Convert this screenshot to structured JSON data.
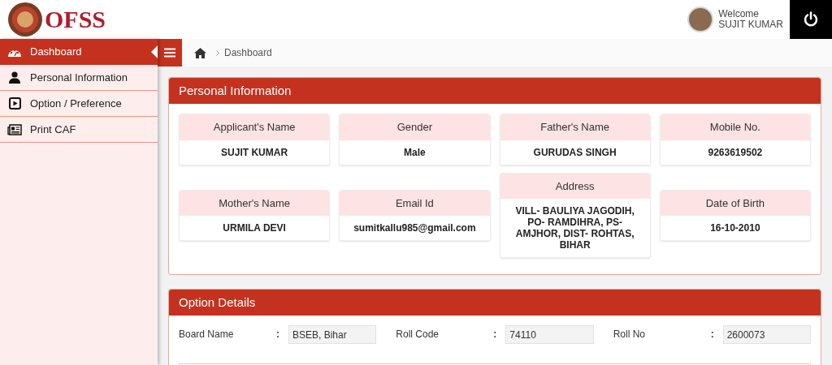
{
  "header": {
    "logo_text": "OFSS",
    "welcome": "Welcome",
    "user_name": "SUJIT KUMAR"
  },
  "sidebar": {
    "items": [
      {
        "label": "Dashboard",
        "selected": true
      },
      {
        "label": "Personal Information",
        "selected": false
      },
      {
        "label": "Option / Preference",
        "selected": false
      },
      {
        "label": "Print CAF",
        "selected": false
      }
    ]
  },
  "breadcrumb": {
    "items": [
      "Dashboard"
    ]
  },
  "personal_information": {
    "title": "Personal Information",
    "fields": [
      {
        "label": "Applicant's Name",
        "value": "SUJIT KUMAR"
      },
      {
        "label": "Gender",
        "value": "Male"
      },
      {
        "label": "Father's Name",
        "value": "GURUDAS SINGH"
      },
      {
        "label": "Mobile No.",
        "value": "9263619502"
      },
      {
        "label": "Mother's Name",
        "value": "URMILA DEVI"
      },
      {
        "label": "Email Id",
        "value": "sumitkallu985@gmail.com"
      },
      {
        "label": "Address",
        "value": "VILL- BAULIYA JAGODIH, PO- RAMDIHRA, PS- AMJHOR, DIST- ROHTAS, BIHAR"
      },
      {
        "label": "Date of Birth",
        "value": "16-10-2010"
      }
    ]
  },
  "option_details": {
    "title": "Option Details",
    "fields": [
      {
        "label": "Board Name",
        "separator": ":",
        "value": "BSEB, Bihar"
      },
      {
        "label": "Roll Code",
        "separator": ":",
        "value": "74110"
      },
      {
        "label": "Roll No",
        "separator": ":",
        "value": "2600073"
      }
    ]
  }
}
